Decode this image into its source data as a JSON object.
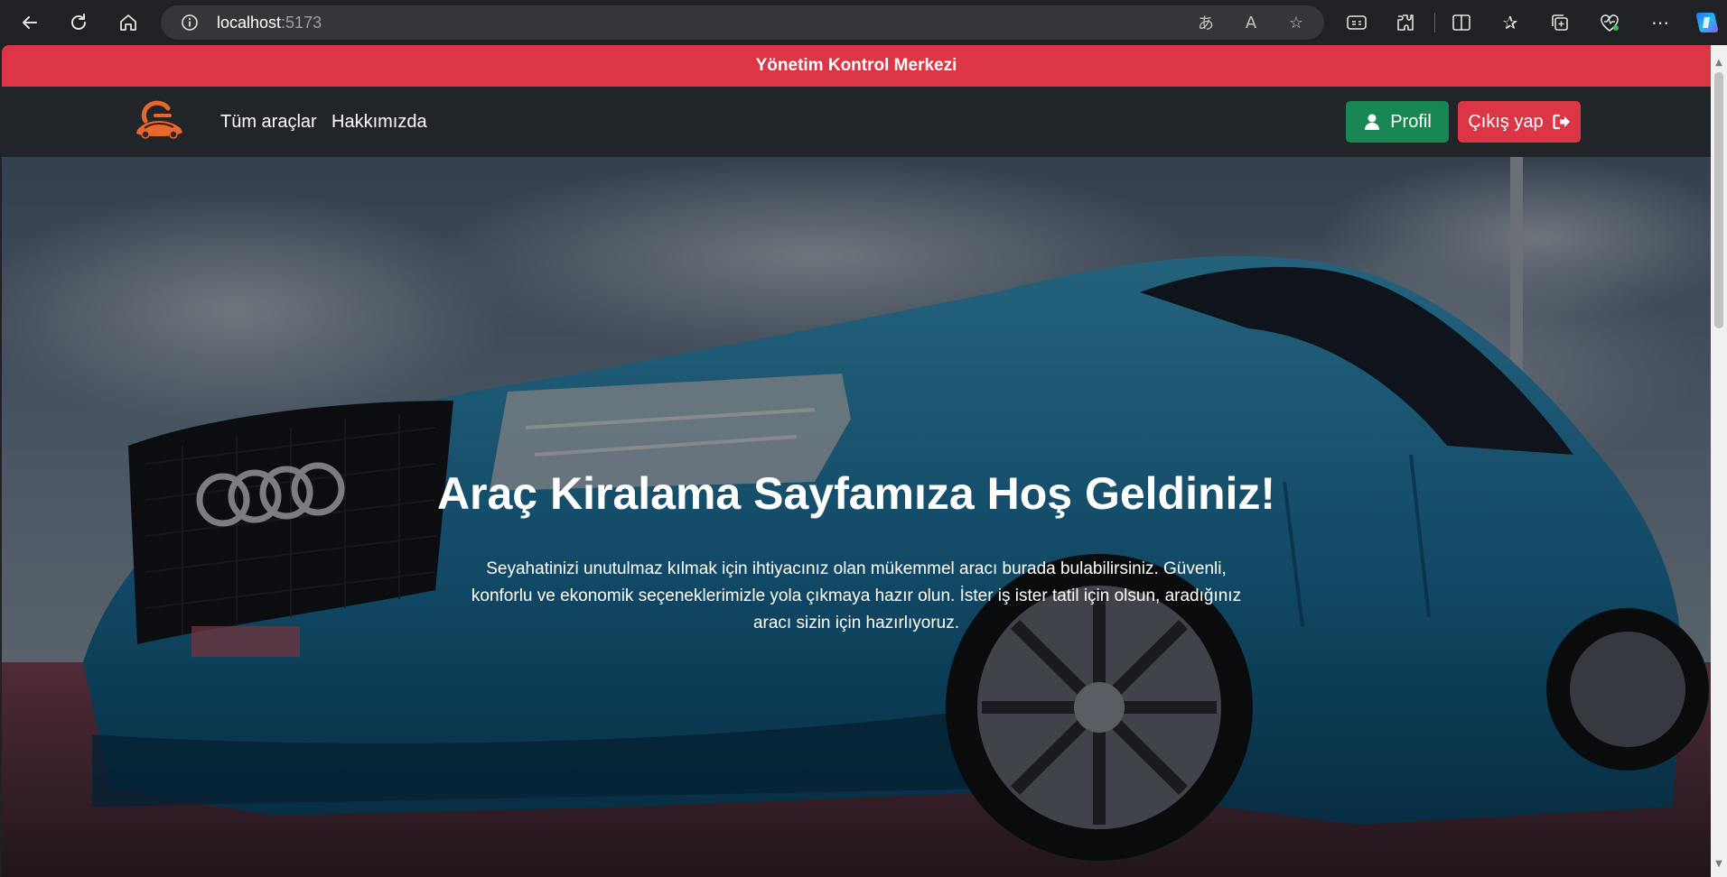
{
  "browser": {
    "url_host": "localhost",
    "url_port": ":5173",
    "icons": [
      "back-icon",
      "reload-icon",
      "home-icon",
      "site-info-icon",
      "translate-icon",
      "read-aloud-icon",
      "favorite-star-icon",
      "immersive-reader-icon",
      "extensions-icon",
      "split-screen-icon",
      "favorites-icon",
      "collections-icon",
      "browser-essentials-icon",
      "more-icon",
      "copilot-icon"
    ]
  },
  "banner": {
    "title": "Yönetim Kontrol Merkezi",
    "color": "#dc3545"
  },
  "navbar": {
    "links": [
      "Tüm araçlar",
      "Hakkımızda"
    ],
    "profile_label": "Profil",
    "logout_label": "Çıkış yap",
    "profile_color": "#198754",
    "logout_color": "#dc3545"
  },
  "hero": {
    "title": "Araç Kiralama Sayfamıza Hoş Geldiniz!",
    "description": "Seyahatinizi unutulmaz kılmak için ihtiyacınız olan mükemmel aracı burada bulabilirsiniz. Güvenli, konforlu ve ekonomik seçeneklerimizle yola çıkmaya hazır olun. İster iş ister tatil için olsun, aradığınız aracı sizin için hazırlıyoruz."
  }
}
